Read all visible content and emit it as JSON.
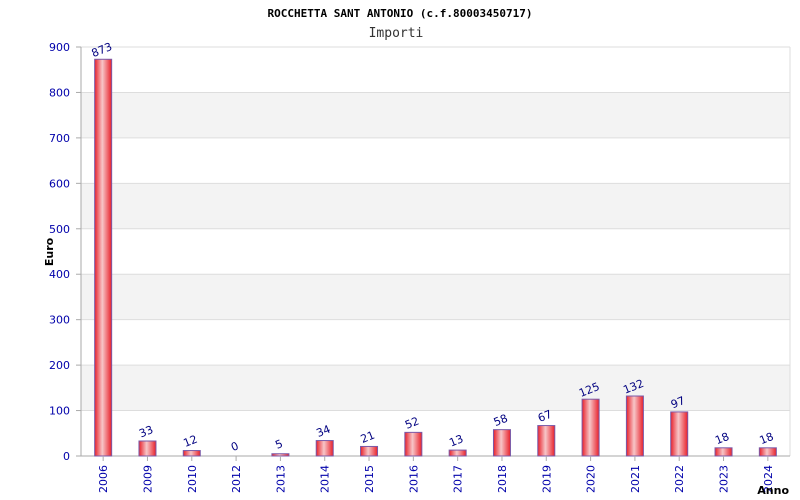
{
  "chart_data": {
    "type": "bar",
    "title": "ROCCHETTA SANT ANTONIO (c.f.80003450717)",
    "subtitle": "Importi",
    "ylabel": "Euro",
    "xlabel": "Anno",
    "categories": [
      "2006",
      "2009",
      "2010",
      "2012",
      "2013",
      "2014",
      "2015",
      "2016",
      "2017",
      "2018",
      "2019",
      "2020",
      "2021",
      "2022",
      "2023",
      "2024"
    ],
    "values": [
      873,
      33,
      12,
      0,
      5,
      34,
      21,
      52,
      13,
      58,
      67,
      125,
      132,
      97,
      18,
      18
    ],
    "ylim": [
      0,
      900
    ],
    "yticks": [
      0,
      100,
      200,
      300,
      400,
      500,
      600,
      700,
      800,
      900
    ],
    "grid": true,
    "colors": {
      "bar": "#e8202a",
      "bar_highlight": "#f7c6c8",
      "bar_edge": "#7a5aa8",
      "band": "#f3f3f3",
      "grid": "#dddddd",
      "axis": "#aaaaaa",
      "tick_text": "#0000aa",
      "label_text": "#000080"
    }
  }
}
